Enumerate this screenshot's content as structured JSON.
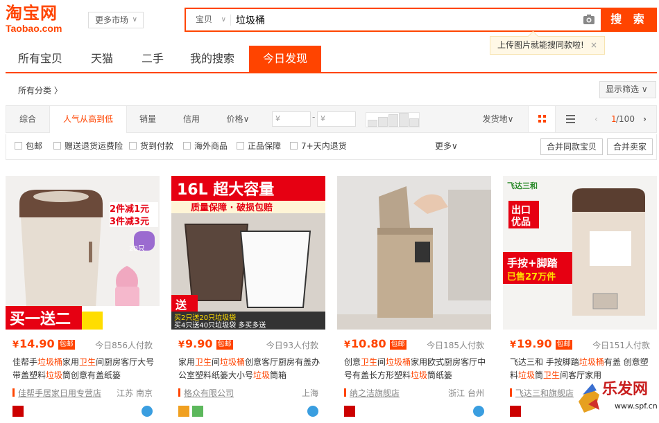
{
  "logo": {
    "cn": "淘宝网",
    "en": "Taobao.com"
  },
  "market_select": {
    "label": "更多市场"
  },
  "search": {
    "category": "宝贝",
    "query": "垃圾桶",
    "button": "搜 索",
    "upload_tip": "上传图片就能搜同款啦!",
    "tip_close": "×"
  },
  "tabs": [
    {
      "label": "所有宝贝"
    },
    {
      "label": "天猫"
    },
    {
      "label": "二手"
    },
    {
      "label": "我的搜索"
    },
    {
      "label": "今日发现",
      "active": true
    }
  ],
  "category_bar": {
    "all_categories": "所有分类 〉",
    "display_filter": "显示筛选 ∨"
  },
  "sort": {
    "items": [
      "综合",
      "人气从高到低",
      "销量",
      "信用",
      "价格∨"
    ],
    "active_index": 1,
    "price_min_placeholder": "¥",
    "price_max_placeholder": "¥",
    "price_dash": "-",
    "ship_from": "发货地∨",
    "page_current": "1",
    "page_total": "/100"
  },
  "options": {
    "checkboxes": [
      "包邮",
      "赠送退货运费险",
      "货到付款",
      "海外商品",
      "正品保障",
      "7+天内退货"
    ],
    "more": "更多∨",
    "merge_same": "合并同款宝贝",
    "merge_seller": "合并卖家"
  },
  "products": [
    {
      "price": "14.90",
      "currency": "¥",
      "free_ship": "包邮",
      "deals": "今日856人付款",
      "title_parts": [
        "佳帮手",
        "垃圾桶",
        "家用",
        "卫生",
        "间厨房客厅大号带盖塑料",
        "垃圾",
        "筒创意有盖纸篓"
      ],
      "shop": "佳帮手居家日用专营店",
      "location": "江苏 南京",
      "image_text": {
        "promo1": "2件减1元",
        "promo2": "3件减3元",
        "bag": "20只",
        "banner": "买一送二"
      }
    },
    {
      "price": "9.90",
      "currency": "¥",
      "free_ship": "包邮",
      "deals": "今日93人付款",
      "title_parts": [
        "家用",
        "卫生",
        "间",
        "垃圾桶",
        "创意客厅厨房有盖办公室塑料纸篓大小号",
        "垃圾",
        "筒箱"
      ],
      "shop": "格众有限公司",
      "location": "上海",
      "image_text": {
        "headline": "16L 超大容量",
        "sub": "质量保障 · 破损包赔",
        "banner": "送",
        "line1": "买2只送20只垃圾袋",
        "line2": "买4只送40只垃圾袋 多买多送"
      }
    },
    {
      "price": "10.80",
      "currency": "¥",
      "free_ship": "包邮",
      "deals": "今日185人付款",
      "title_parts": [
        "创意",
        "卫生",
        "间",
        "垃圾桶",
        "家用欧式厨房客厅中号有盖长方形塑料",
        "垃圾",
        "筒纸篓"
      ],
      "shop": "纳之洁旗舰店",
      "location": "浙江 台州",
      "image_text": {}
    },
    {
      "price": "19.90",
      "currency": "¥",
      "free_ship": "包邮",
      "deals": "今日151人付款",
      "title_parts": [
        "飞达三和 手按脚踏",
        "垃圾桶",
        "有盖 创意塑料",
        "垃圾",
        "筒",
        "卫生",
        "间客厅家用"
      ],
      "shop": "飞达三和旗舰店",
      "location": "",
      "image_text": {
        "brand": "飞达三和",
        "export": "出口优品",
        "feature": "手按+脚踏",
        "sold": "已售27万件"
      }
    }
  ],
  "watermark": {
    "cn": "乐发网",
    "url": "www.spf.cn"
  },
  "colors": {
    "accent": "#ff4400",
    "text": "#3c3c3c",
    "muted": "#888888"
  }
}
